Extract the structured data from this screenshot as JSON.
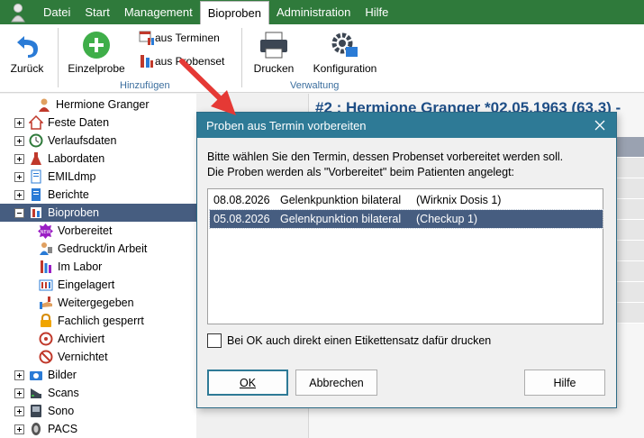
{
  "menu": {
    "items": [
      "Datei",
      "Start",
      "Management",
      "Bioproben",
      "Administration",
      "Hilfe"
    ],
    "active_index": 3
  },
  "ribbon": {
    "back": "Zurück",
    "single_sample": "Einzelprobe",
    "from_appointments": "aus Terminen",
    "from_sampleset": "aus Probenset",
    "group_add": "Hinzufügen",
    "print": "Drucken",
    "config": "Konfiguration",
    "group_admin": "Verwaltung"
  },
  "tree": {
    "patient": "Hermione Granger",
    "items": [
      {
        "label": "Feste Daten",
        "icon": "house-icon"
      },
      {
        "label": "Verlaufsdaten",
        "icon": "clock-icon"
      },
      {
        "label": "Labordaten",
        "icon": "flask-icon"
      },
      {
        "label": "EMILdmp",
        "icon": "document-icon"
      },
      {
        "label": "Berichte",
        "icon": "report-icon"
      },
      {
        "label": "Bioproben",
        "icon": "sample-icon"
      }
    ],
    "sub_items": [
      {
        "label": "Vorbereitet",
        "icon": "new-badge-icon"
      },
      {
        "label": "Gedruckt/in Arbeit",
        "icon": "worker-icon"
      },
      {
        "label": "Im Labor",
        "icon": "lab-icon"
      },
      {
        "label": "Eingelagert",
        "icon": "storage-icon"
      },
      {
        "label": "Weitergegeben",
        "icon": "handover-icon"
      },
      {
        "label": "Fachlich gesperrt",
        "icon": "lock-icon"
      },
      {
        "label": "Archiviert",
        "icon": "archive-icon"
      },
      {
        "label": "Vernichtet",
        "icon": "forbidden-icon"
      }
    ],
    "more_items": [
      {
        "label": "Bilder",
        "icon": "camera-icon"
      },
      {
        "label": "Scans",
        "icon": "scanner-icon"
      },
      {
        "label": "Sono",
        "icon": "ultrasound-icon"
      },
      {
        "label": "PACS",
        "icon": "pacs-icon"
      }
    ]
  },
  "background": {
    "patient_title": "#2 : Hermione Granger *02.05.1963 (63,3) -"
  },
  "dialog": {
    "title": "Proben aus Termin vorbereiten",
    "line1": "Bitte wählen Sie den Termin, dessen Probenset vorbereitet werden soll.",
    "line2": "Die Proben werden als \"Vorbereitet\" beim Patienten angelegt:",
    "rows": [
      {
        "date": "08.08.2026",
        "procedure": "Gelenkpunktion bilateral",
        "set": "(Wirknix Dosis 1)"
      },
      {
        "date": "05.08.2026",
        "procedure": "Gelenkpunktion bilateral",
        "set": "(Checkup 1)"
      }
    ],
    "selected_row": 1,
    "checkbox_label": "Bei OK auch direkt einen Etikettensatz dafür drucken",
    "ok": "OK",
    "cancel": "Abbrechen",
    "help": "Hilfe"
  }
}
